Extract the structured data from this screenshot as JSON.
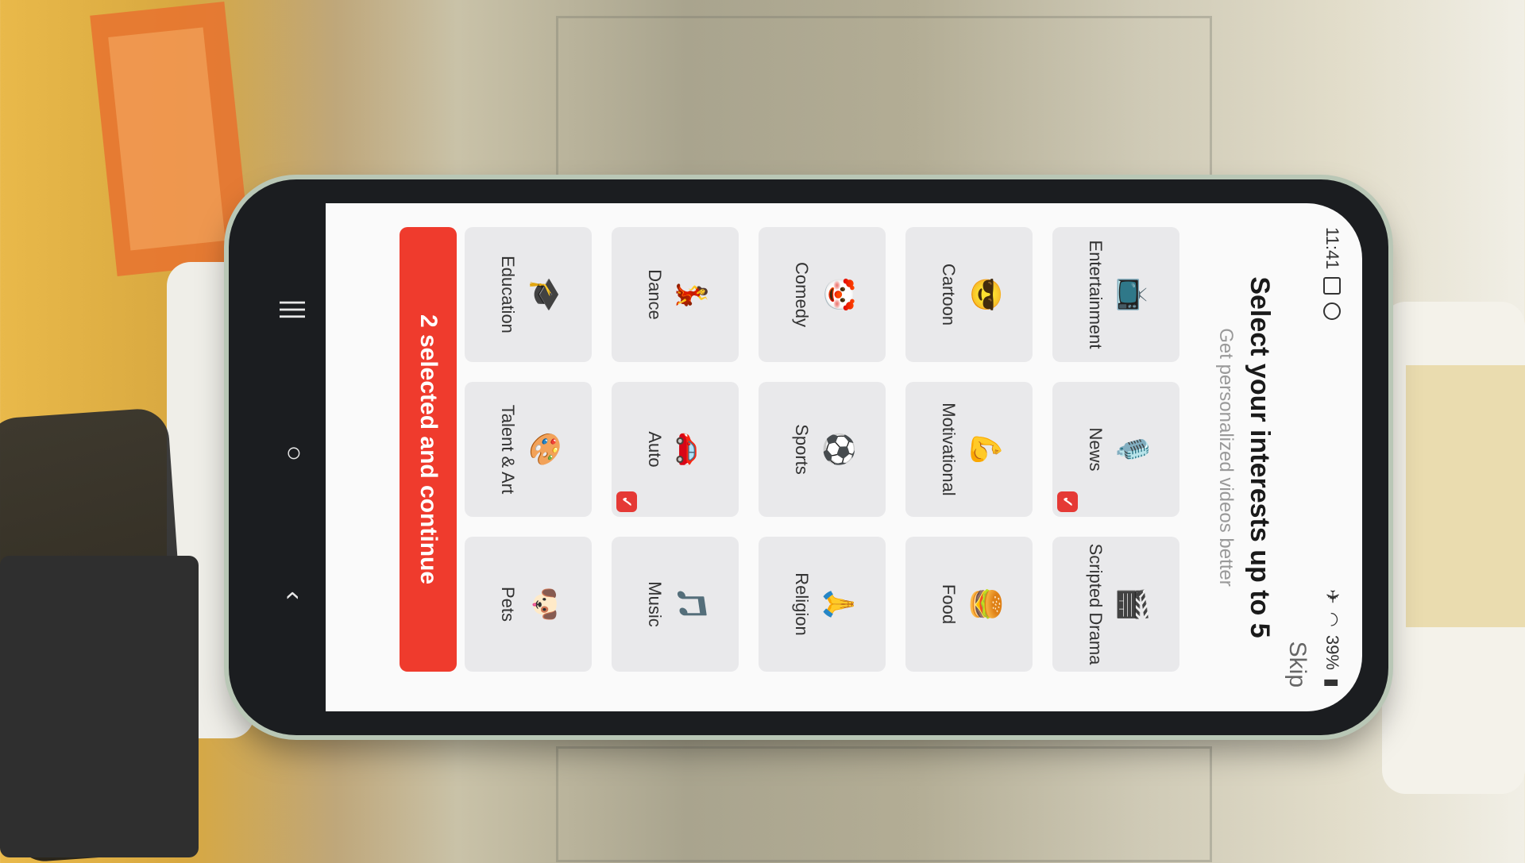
{
  "status_bar": {
    "time": "11:41",
    "battery": "39%"
  },
  "header": {
    "skip_label": "Skip",
    "title": "Select your interests up to 5",
    "subtitle": "Get personalized videos better"
  },
  "interests": [
    {
      "label": "Entertainment",
      "emoji": "📺",
      "icon": "tv-icon",
      "selected": false
    },
    {
      "label": "News",
      "emoji": "🎙️",
      "icon": "microphone-icon",
      "selected": true
    },
    {
      "label": "Scripted Drama",
      "emoji": "🎬",
      "icon": "clapperboard-icon",
      "selected": false
    },
    {
      "label": "Cartoon",
      "emoji": "😎",
      "icon": "cartoon-face-icon",
      "selected": false
    },
    {
      "label": "Motivational",
      "emoji": "💪",
      "icon": "motivational-icon",
      "selected": false
    },
    {
      "label": "Food",
      "emoji": "🍔",
      "icon": "burger-icon",
      "selected": false
    },
    {
      "label": "Comedy",
      "emoji": "🤡",
      "icon": "clown-icon",
      "selected": false
    },
    {
      "label": "Sports",
      "emoji": "⚽",
      "icon": "soccer-ball-icon",
      "selected": false
    },
    {
      "label": "Religion",
      "emoji": "🙏",
      "icon": "praying-hands-icon",
      "selected": false
    },
    {
      "label": "Dance",
      "emoji": "💃",
      "icon": "dancer-icon",
      "selected": false
    },
    {
      "label": "Auto",
      "emoji": "🚗",
      "icon": "car-icon",
      "selected": true
    },
    {
      "label": "Music",
      "emoji": "🎵",
      "icon": "music-note-icon",
      "selected": false
    },
    {
      "label": "Education",
      "emoji": "🎓",
      "icon": "graduation-cap-icon",
      "selected": false
    },
    {
      "label": "Talent & Art",
      "emoji": "🎨",
      "icon": "artist-icon",
      "selected": false
    },
    {
      "label": "Pets",
      "emoji": "🐶",
      "icon": "dog-icon",
      "selected": false
    }
  ],
  "cta": {
    "label": "2 selected and continue"
  },
  "nav": {
    "recent": "|||",
    "home": "○",
    "back": "‹"
  },
  "colors": {
    "accent": "#ef3b2d",
    "tile_bg": "#e9e9eb"
  }
}
